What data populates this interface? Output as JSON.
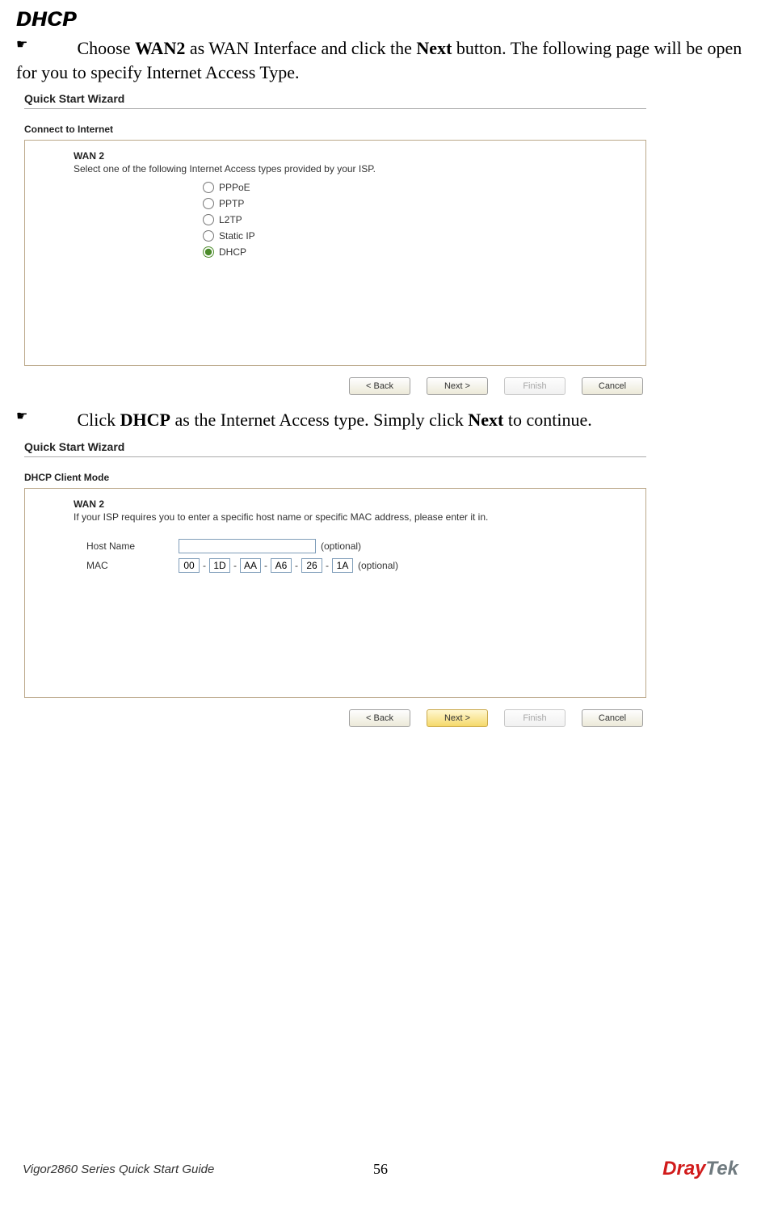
{
  "section_title": "DHCP",
  "step1": {
    "text_pre": "Choose ",
    "bold1": "WAN2",
    "text_mid": " as WAN Interface and click the ",
    "bold2": "Next",
    "text_post": " button. The following page will be open for you to specify Internet Access Type."
  },
  "wizard1": {
    "title": "Quick Start Wizard",
    "subtitle": "Connect to Internet",
    "wan": "WAN 2",
    "prompt": "Select one of the following Internet Access types provided by your ISP.",
    "options": [
      "PPPoE",
      "PPTP",
      "L2TP",
      "Static IP",
      "DHCP"
    ],
    "selected": "DHCP",
    "buttons": {
      "back": "< Back",
      "next": "Next >",
      "finish": "Finish",
      "cancel": "Cancel"
    }
  },
  "step2": {
    "text_pre": "Click ",
    "bold1": "DHCP",
    "text_mid": " as the Internet Access type. Simply click ",
    "bold2": "Next",
    "text_post": " to continue."
  },
  "wizard2": {
    "title": "Quick Start Wizard",
    "subtitle": "DHCP Client Mode",
    "wan": "WAN 2",
    "prompt": "If your ISP requires you to enter a specific host name or specific MAC address, please enter it in.",
    "host_label": "Host Name",
    "host_optional": "(optional)",
    "mac_label": "MAC",
    "mac_values": [
      "00",
      "1D",
      "AA",
      "A6",
      "26",
      "1A"
    ],
    "mac_optional": "(optional)",
    "buttons": {
      "back": "< Back",
      "next": "Next >",
      "finish": "Finish",
      "cancel": "Cancel"
    }
  },
  "footer": {
    "left": "Vigor2860 Series Quick Start Guide",
    "page": "56",
    "brand_red": "Dray",
    "brand_grey": "Tek"
  }
}
